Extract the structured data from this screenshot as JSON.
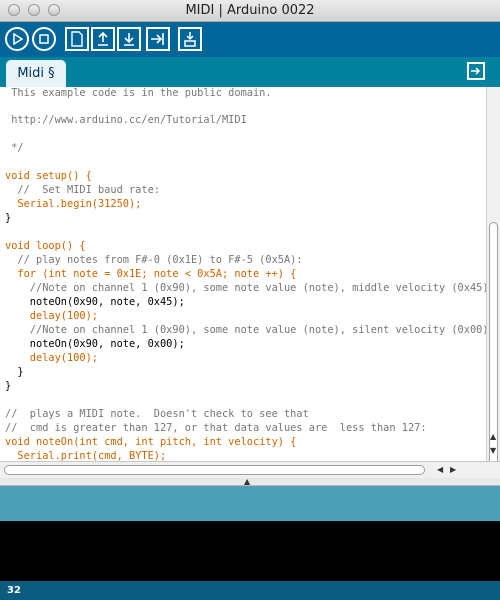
{
  "window": {
    "title": "MIDI | Arduino 0022"
  },
  "toolbar": {
    "buttons": [
      {
        "name": "verify-button",
        "icon": "play-icon"
      },
      {
        "name": "stop-button",
        "icon": "stop-icon"
      },
      {
        "name": "new-button",
        "icon": "new-file-icon"
      },
      {
        "name": "open-button",
        "icon": "open-arrow-icon"
      },
      {
        "name": "save-button",
        "icon": "save-arrow-icon"
      },
      {
        "name": "upload-button",
        "icon": "upload-icon"
      },
      {
        "name": "serial-monitor-button",
        "icon": "serial-monitor-icon"
      }
    ]
  },
  "tabs": [
    {
      "label": "Midi §"
    }
  ],
  "code": [
    " This example code is in the public domain.",
    "",
    " http://www.arduino.cc/en/Tutorial/MIDI",
    "",
    " */",
    "",
    "void setup() {",
    "  //  Set MIDI baud rate:",
    "  Serial.begin(31250);",
    "}",
    "",
    "void loop() {",
    "  // play notes from F#-0 (0x1E) to F#-5 (0x5A):",
    "  for (int note = 0x1E; note < 0x5A; note ++) {",
    "    //Note on channel 1 (0x90), some note value (note), middle velocity (0x45):",
    "    noteOn(0x90, note, 0x45);",
    "    delay(100);",
    "    //Note on channel 1 (0x90), some note value (note), silent velocity (0x00):",
    "    noteOn(0x90, note, 0x00);",
    "    delay(100);",
    "  }",
    "}",
    "",
    "//  plays a MIDI note.  Doesn't check to see that",
    "//  cmd is greater than 127, or that data values are  less than 127:",
    "void noteOn(int cmd, int pitch, int velocity) {",
    "  Serial.print(cmd, BYTE);"
  ],
  "status": {
    "message": ""
  },
  "footer": {
    "line_number": "32"
  },
  "colors": {
    "toolbar": "#006699",
    "tabbar": "#04819e",
    "status_bar": "#4d9fb5",
    "comment": "#777777",
    "keyword": "#cc6600",
    "constant": "#006699"
  }
}
